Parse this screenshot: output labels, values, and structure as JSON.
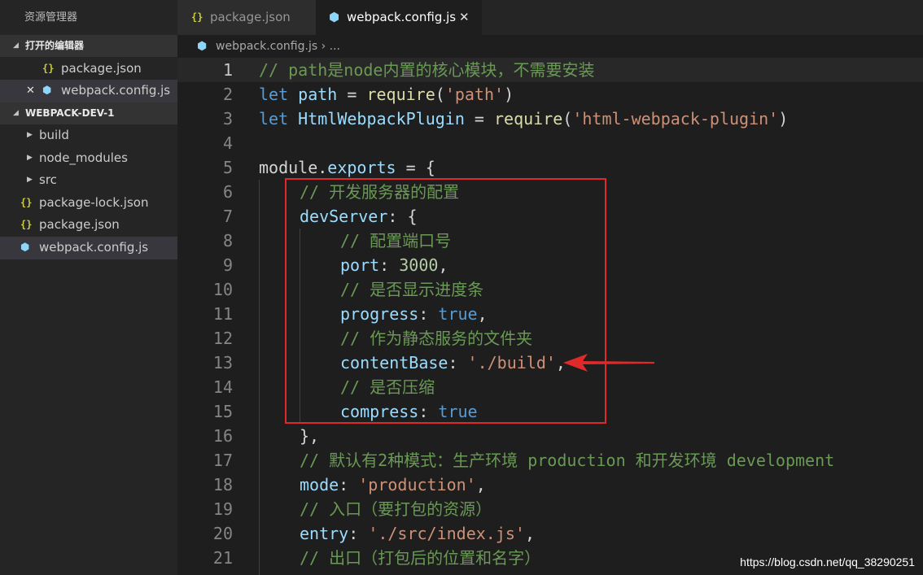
{
  "sidebar": {
    "title": "资源管理器",
    "open_editors": {
      "header": "打开的编辑器",
      "items": [
        {
          "icon": "{}",
          "label": "package.json"
        },
        {
          "close": "✕",
          "icon": "⬢",
          "label": "webpack.config.js"
        }
      ]
    },
    "project": {
      "header": "WEBPACK-DEV-1",
      "items": [
        {
          "icon": "›",
          "label": "build"
        },
        {
          "icon": "›",
          "label": "node_modules"
        },
        {
          "icon": "›",
          "label": "src"
        },
        {
          "icon": "{}",
          "label": "package-lock.json"
        },
        {
          "icon": "{}",
          "label": "package.json"
        },
        {
          "icon": "⬢",
          "label": "webpack.config.js"
        }
      ]
    }
  },
  "tabs": [
    {
      "icon": "{}",
      "label": "package.json"
    },
    {
      "icon": "⬢",
      "label": "webpack.config.js",
      "close": "✕"
    }
  ],
  "breadcrumb": {
    "icon": "⬢",
    "text": "webpack.config.js › ..."
  },
  "editor": {
    "lines": [
      {
        "num": "1",
        "indent": 0,
        "tokens": [
          [
            "c-com",
            "// path是node内置的核心模块，不需要安装"
          ]
        ]
      },
      {
        "num": "2",
        "indent": 0,
        "tokens": [
          [
            "c-kw",
            "let"
          ],
          [
            "c-pun",
            " "
          ],
          [
            "c-var",
            "path"
          ],
          [
            "c-pun",
            " = "
          ],
          [
            "c-fn",
            "require"
          ],
          [
            "c-pun",
            "("
          ],
          [
            "c-str",
            "'path'"
          ],
          [
            "c-pun",
            ")"
          ]
        ]
      },
      {
        "num": "3",
        "indent": 0,
        "tokens": [
          [
            "c-kw",
            "let"
          ],
          [
            "c-pun",
            " "
          ],
          [
            "c-var",
            "HtmlWebpackPlugin"
          ],
          [
            "c-pun",
            " = "
          ],
          [
            "c-fn",
            "require"
          ],
          [
            "c-pun",
            "("
          ],
          [
            "c-str",
            "'html-webpack-plugin'"
          ],
          [
            "c-pun",
            ")"
          ]
        ]
      },
      {
        "num": "4",
        "indent": 0,
        "tokens": []
      },
      {
        "num": "5",
        "indent": 0,
        "tokens": [
          [
            "c-pun",
            "module."
          ],
          [
            "c-var",
            "exports"
          ],
          [
            "c-pun",
            " = {"
          ]
        ]
      },
      {
        "num": "6",
        "indent": 1,
        "tokens": [
          [
            "c-com",
            "// 开发服务器的配置"
          ]
        ]
      },
      {
        "num": "7",
        "indent": 1,
        "tokens": [
          [
            "c-var",
            "devServer"
          ],
          [
            "c-pun",
            ": {"
          ]
        ]
      },
      {
        "num": "8",
        "indent": 2,
        "tokens": [
          [
            "c-com",
            "// 配置端口号"
          ]
        ]
      },
      {
        "num": "9",
        "indent": 2,
        "tokens": [
          [
            "c-var",
            "port"
          ],
          [
            "c-pun",
            ": "
          ],
          [
            "c-num",
            "3000"
          ],
          [
            "c-pun",
            ","
          ]
        ]
      },
      {
        "num": "10",
        "indent": 2,
        "tokens": [
          [
            "c-com",
            "// 是否显示进度条"
          ]
        ]
      },
      {
        "num": "11",
        "indent": 2,
        "tokens": [
          [
            "c-var",
            "progress"
          ],
          [
            "c-pun",
            ": "
          ],
          [
            "c-kw",
            "true"
          ],
          [
            "c-pun",
            ","
          ]
        ]
      },
      {
        "num": "12",
        "indent": 2,
        "tokens": [
          [
            "c-com",
            "// 作为静态服务的文件夹"
          ]
        ]
      },
      {
        "num": "13",
        "indent": 2,
        "tokens": [
          [
            "c-var",
            "contentBase"
          ],
          [
            "c-pun",
            ": "
          ],
          [
            "c-str",
            "'./build'"
          ],
          [
            "c-pun",
            ","
          ]
        ]
      },
      {
        "num": "14",
        "indent": 2,
        "tokens": [
          [
            "c-com",
            "// 是否压缩"
          ]
        ]
      },
      {
        "num": "15",
        "indent": 2,
        "tokens": [
          [
            "c-var",
            "compress"
          ],
          [
            "c-pun",
            ": "
          ],
          [
            "c-kw",
            "true"
          ]
        ]
      },
      {
        "num": "16",
        "indent": 1,
        "tokens": [
          [
            "c-pun",
            "},"
          ]
        ]
      },
      {
        "num": "17",
        "indent": 1,
        "tokens": [
          [
            "c-com",
            "// 默认有2种模式：生产环境 production 和开发环境 development"
          ]
        ]
      },
      {
        "num": "18",
        "indent": 1,
        "tokens": [
          [
            "c-var",
            "mode"
          ],
          [
            "c-pun",
            ": "
          ],
          [
            "c-str",
            "'production'"
          ],
          [
            "c-pun",
            ","
          ]
        ]
      },
      {
        "num": "19",
        "indent": 1,
        "tokens": [
          [
            "c-com",
            "// 入口（要打包的资源）"
          ]
        ]
      },
      {
        "num": "20",
        "indent": 1,
        "tokens": [
          [
            "c-var",
            "entry"
          ],
          [
            "c-pun",
            ": "
          ],
          [
            "c-str",
            "'./src/index.js'"
          ],
          [
            "c-pun",
            ","
          ]
        ]
      },
      {
        "num": "21",
        "indent": 1,
        "tokens": [
          [
            "c-com",
            "// 出口（打包后的位置和名字）"
          ]
        ]
      }
    ],
    "current_line": "1"
  },
  "watermark": "https://blog.csdn.net/qq_38290251",
  "colors": {
    "highlight_box": "#e0292b",
    "arrow": "#e0292b",
    "json_icon": "#cbcb41",
    "webpack_icon": "#8dd6f9"
  }
}
